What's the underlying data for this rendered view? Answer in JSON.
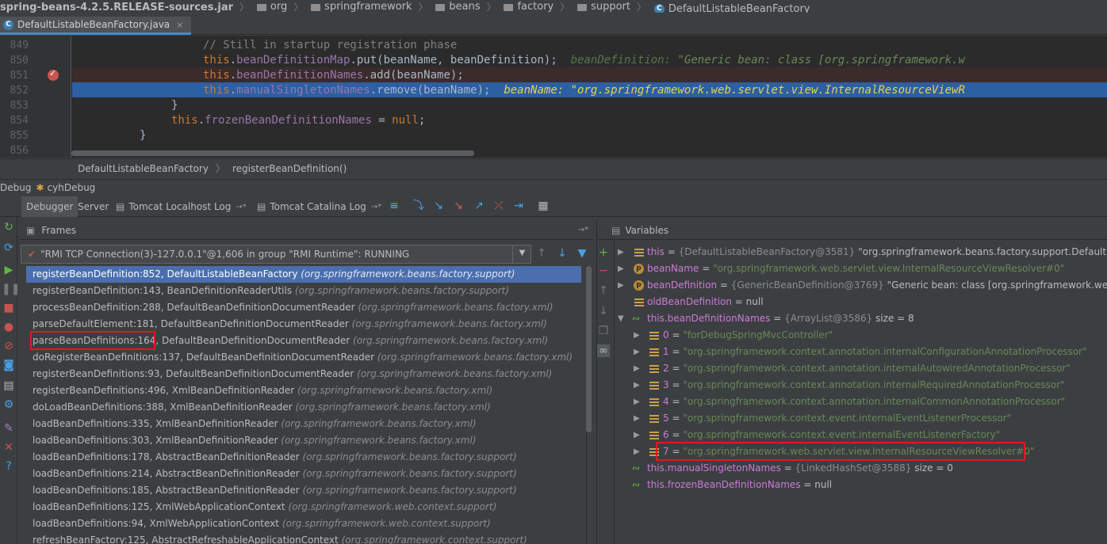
{
  "navbar": {
    "crumbs": [
      "spring-beans-4.2.5.RELEASE-sources.jar",
      "org",
      "springframework",
      "beans",
      "factory",
      "support",
      "DefaultListableBeanFactory"
    ]
  },
  "editor": {
    "tab_label": "DefaultListableBeanFactory.java",
    "lines": [
      {
        "num": "849",
        "text": "// Still in startup registration phase"
      },
      {
        "num": "850",
        "kw": "this",
        "field": "beanDefinitionMap",
        "rest": ".put(beanName, beanDefinition);",
        "inline_name": "beanDefinition:",
        "inline_value": "\"Generic bean: class [org.springframework.w"
      },
      {
        "num": "851",
        "kw": "this",
        "field": "beanDefinitionNames",
        "rest": ".add(beanName);"
      },
      {
        "num": "852",
        "kw": "this",
        "field": "manualSingletonNames",
        "rest": ".remove(beanName);",
        "inline_name": "beanName:",
        "inline_value": "\"org.springframework.web.servlet.view.InternalResourceViewR"
      },
      {
        "num": "853",
        "text": "}"
      },
      {
        "num": "854",
        "kw": "this",
        "field": "frozenBeanDefinitionNames",
        "rest": " = ",
        "kw2": "null",
        "tail": ";"
      },
      {
        "num": "855",
        "text": "}"
      },
      {
        "num": "856",
        "text": ""
      }
    ],
    "breadcrumb": [
      "DefaultListableBeanFactory",
      "registerBeanDefinition()"
    ]
  },
  "debug": {
    "title": "Debug",
    "config": "cyhDebug",
    "tabs": [
      "Debugger",
      "Server",
      "Tomcat Localhost Log",
      "Tomcat Catalina Log"
    ],
    "tab_pin": "→*"
  },
  "frames": {
    "header": "Frames",
    "thread": "\"RMI TCP Connection(3)-127.0.0.1\"@1,606 in group \"RMI Runtime\": RUNNING",
    "rows": [
      {
        "m": "registerBeanDefinition:852, DefaultListableBeanFactory",
        "p": "(org.springframework.beans.factory.support)"
      },
      {
        "m": "registerBeanDefinition:143, BeanDefinitionReaderUtils",
        "p": "(org.springframework.beans.factory.support)"
      },
      {
        "m": "processBeanDefinition:288, DefaultBeanDefinitionDocumentReader",
        "p": "(org.springframework.beans.factory.xml)"
      },
      {
        "m": "parseDefaultElement:181, DefaultBeanDefinitionDocumentReader",
        "p": "(org.springframework.beans.factory.xml)"
      },
      {
        "m": "parseBeanDefinitions:164, DefaultBeanDefinitionDocumentReader",
        "p": "(org.springframework.beans.factory.xml)"
      },
      {
        "m": "doRegisterBeanDefinitions:137, DefaultBeanDefinitionDocumentReader",
        "p": "(org.springframework.beans.factory.xml)"
      },
      {
        "m": "registerBeanDefinitions:93, DefaultBeanDefinitionDocumentReader",
        "p": "(org.springframework.beans.factory.xml)"
      },
      {
        "m": "registerBeanDefinitions:496, XmlBeanDefinitionReader",
        "p": "(org.springframework.beans.factory.xml)"
      },
      {
        "m": "doLoadBeanDefinitions:388, XmlBeanDefinitionReader",
        "p": "(org.springframework.beans.factory.xml)"
      },
      {
        "m": "loadBeanDefinitions:335, XmlBeanDefinitionReader",
        "p": "(org.springframework.beans.factory.xml)"
      },
      {
        "m": "loadBeanDefinitions:303, XmlBeanDefinitionReader",
        "p": "(org.springframework.beans.factory.xml)"
      },
      {
        "m": "loadBeanDefinitions:178, AbstractBeanDefinitionReader",
        "p": "(org.springframework.beans.factory.support)"
      },
      {
        "m": "loadBeanDefinitions:214, AbstractBeanDefinitionReader",
        "p": "(org.springframework.beans.factory.support)"
      },
      {
        "m": "loadBeanDefinitions:185, AbstractBeanDefinitionReader",
        "p": "(org.springframework.beans.factory.support)"
      },
      {
        "m": "loadBeanDefinitions:125, XmlWebApplicationContext",
        "p": "(org.springframework.web.context.support)"
      },
      {
        "m": "loadBeanDefinitions:94, XmlWebApplicationContext",
        "p": "(org.springframework.web.context.support)"
      },
      {
        "m": "refreshBeanFactory:125, AbstractRefreshableApplicationContext",
        "p": "(org.springframework.context.support)"
      }
    ]
  },
  "variables": {
    "header": "Variables",
    "this": {
      "name": "this",
      "meta": "{DefaultListableBeanFactory@3581}",
      "val": "\"org.springframework.beans.factory.support.DefaultListab"
    },
    "beanName": {
      "name": "beanName",
      "val": "\"org.springframework.web.servlet.view.InternalResourceViewResolver#0\""
    },
    "beanDefinition": {
      "name": "beanDefinition",
      "meta": "{GenericBeanDefinition@3769}",
      "val": "\"Generic bean: class [org.springframework.web.serv"
    },
    "oldBeanDefinition": {
      "name": "oldBeanDefinition",
      "val": "null"
    },
    "names": {
      "name": "this.beanDefinitionNames",
      "meta": "{ArrayList@3586}",
      "val": "size = 8"
    },
    "items": [
      "\"forDebugSpringMvcController\"",
      "\"org.springframework.context.annotation.internalConfigurationAnnotationProcessor\"",
      "\"org.springframework.context.annotation.internalAutowiredAnnotationProcessor\"",
      "\"org.springframework.context.annotation.internalRequiredAnnotationProcessor\"",
      "\"org.springframework.context.annotation.internalCommonAnnotationProcessor\"",
      "\"org.springframework.context.event.internalEventListenerProcessor\"",
      "\"org.springframework.context.event.internalEventListenerFactory\"",
      "\"org.springframework.web.servlet.view.InternalResourceViewResolver#0\""
    ],
    "manual": {
      "name": "this.manualSingletonNames",
      "meta": "{LinkedHashSet@3588}",
      "val": "size = 0"
    },
    "frozen": {
      "name": "this.frozenBeanDefinitionNames",
      "val": "null"
    }
  }
}
